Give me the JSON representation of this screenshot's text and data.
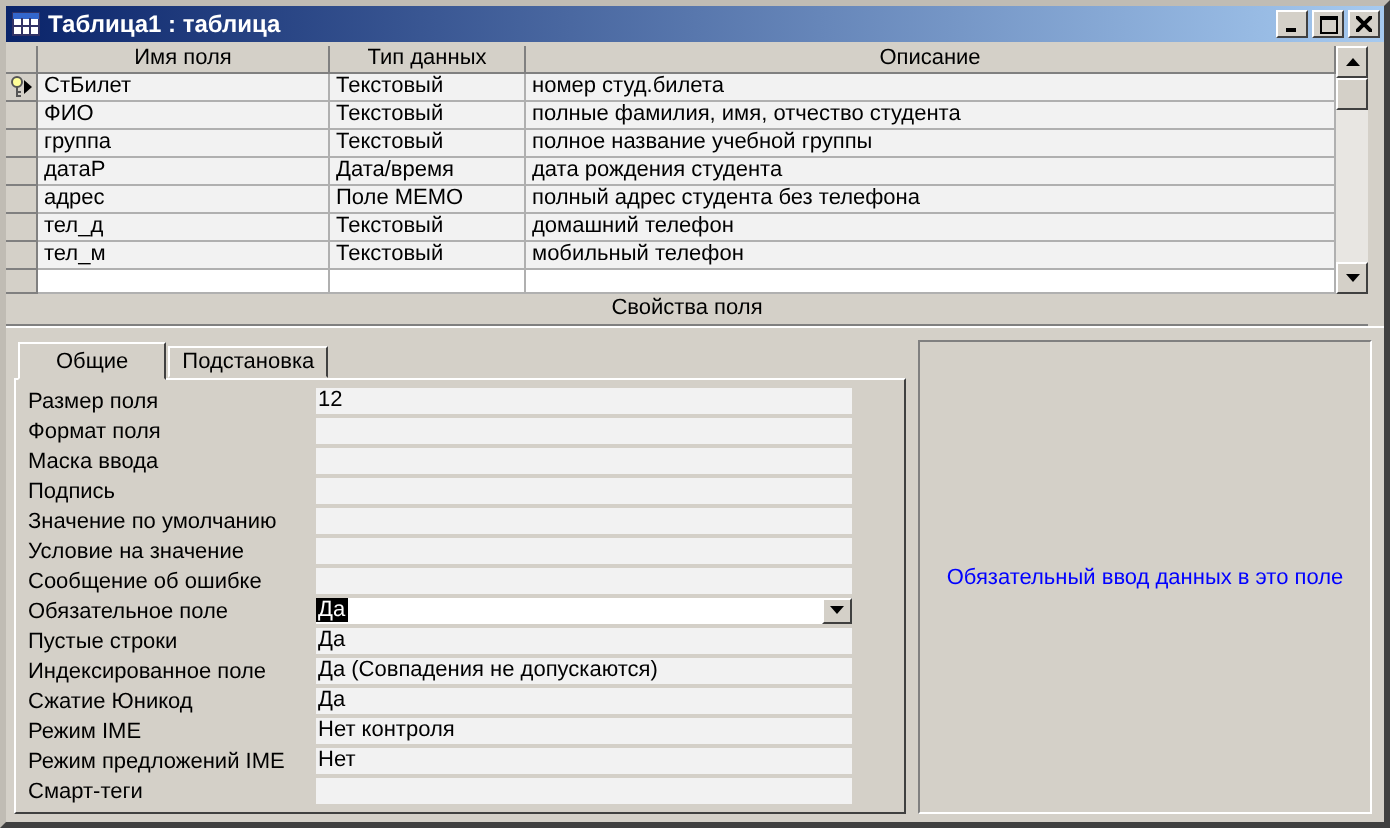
{
  "window": {
    "title": "Таблица1 : таблица"
  },
  "grid": {
    "columns": [
      "Имя поля",
      "Тип данных",
      "Описание"
    ],
    "rows": [
      {
        "name": "СтБилет",
        "type": "Текстовый",
        "description": "номер студ.билета",
        "primary_key": true,
        "current": true
      },
      {
        "name": "ФИО",
        "type": "Текстовый",
        "description": "полные фамилия, имя, отчество студента",
        "primary_key": false,
        "current": false
      },
      {
        "name": "группа",
        "type": "Текстовый",
        "description": "полное название учебной группы",
        "primary_key": false,
        "current": false
      },
      {
        "name": "датаР",
        "type": "Дата/время",
        "description": "дата рождения студента",
        "primary_key": false,
        "current": false
      },
      {
        "name": "адрес",
        "type": "Поле MEMO",
        "description": "полный адрес студента без телефона",
        "primary_key": false,
        "current": false
      },
      {
        "name": "тел_д",
        "type": "Текстовый",
        "description": "домашний телефон",
        "primary_key": false,
        "current": false
      },
      {
        "name": "тел_м",
        "type": "Текстовый",
        "description": "мобильный телефон",
        "primary_key": false,
        "current": false
      }
    ]
  },
  "section_title": "Свойства поля",
  "tabs": [
    {
      "label": "Общие",
      "selected": true
    },
    {
      "label": "Подстановка",
      "selected": false
    }
  ],
  "properties": [
    {
      "label": "Размер поля",
      "value": "12",
      "kind": "text",
      "selected": false
    },
    {
      "label": "Формат поля",
      "kind": "text",
      "selected": false
    },
    {
      "label": "Маска ввода",
      "kind": "text",
      "selected": false
    },
    {
      "label": "Подпись",
      "kind": "text",
      "selected": false
    },
    {
      "label": "Значение по умолчанию",
      "kind": "text",
      "selected": false
    },
    {
      "label": "Условие на значение",
      "kind": "text",
      "selected": false
    },
    {
      "label": "Сообщение об ошибке",
      "kind": "text",
      "selected": false
    },
    {
      "label": "Обязательное поле",
      "value": "Да",
      "kind": "combo",
      "selected": true
    },
    {
      "label": "Пустые строки",
      "value": "Да",
      "kind": "text",
      "selected": false
    },
    {
      "label": "Индексированное поле",
      "value": "Да (Совпадения не допускаются)",
      "kind": "text",
      "selected": false
    },
    {
      "label": "Сжатие Юникод",
      "value": "Да",
      "kind": "text",
      "selected": false
    },
    {
      "label": "Режим IME",
      "value": "Нет контроля",
      "kind": "text",
      "selected": false
    },
    {
      "label": "Режим предложений IME",
      "value": "Нет",
      "kind": "text",
      "selected": false
    },
    {
      "label": "Смарт-теги",
      "kind": "text",
      "selected": false
    }
  ],
  "help_text": "Обязательный ввод данных в это поле"
}
